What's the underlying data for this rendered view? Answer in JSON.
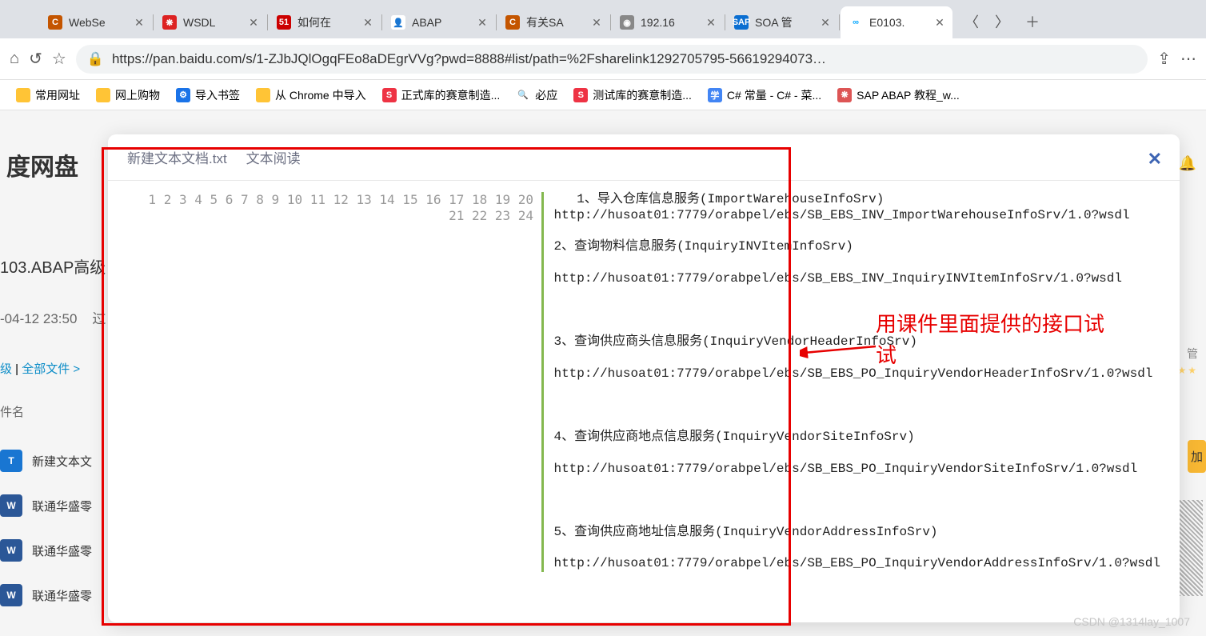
{
  "tabs": [
    {
      "title": "WebSe",
      "fav_bg": "#c45500",
      "fav_txt": "C"
    },
    {
      "title": "WSDL",
      "fav_bg": "#d22",
      "fav_txt": "❋"
    },
    {
      "title": "如何在",
      "fav_bg": "#c00",
      "fav_txt": "51"
    },
    {
      "title": "ABAP",
      "fav_bg": "#fff",
      "fav_txt": "👤",
      "fav_fg": "#333"
    },
    {
      "title": "有关SA",
      "fav_bg": "#c45500",
      "fav_txt": "C"
    },
    {
      "title": "192.16",
      "fav_bg": "#888",
      "fav_txt": "◉"
    },
    {
      "title": "SOA 管",
      "fav_bg": "#0a6ed1",
      "fav_txt": "SAP"
    },
    {
      "title": "E0103.",
      "fav_bg": "#fff",
      "fav_txt": "∞",
      "fav_fg": "#06a7ff",
      "active": true
    }
  ],
  "url": "https://pan.baidu.com/s/1-ZJbJQlOgqFEo8aDEgrVVg?pwd=8888#list/path=%2Fsharelink1292705795-56619294073…",
  "bookmarks": [
    {
      "title": "常用网址",
      "bg": "#ffc436",
      "txt": ""
    },
    {
      "title": "网上购物",
      "bg": "#ffc436",
      "txt": ""
    },
    {
      "title": "导入书签",
      "bg": "#1a73e8",
      "txt": "⚙"
    },
    {
      "title": "从 Chrome 中导入",
      "bg": "#ffc436",
      "txt": ""
    },
    {
      "title": "正式库的赛意制造...",
      "bg": "#e34",
      "txt": "S"
    },
    {
      "title": "必应",
      "bg": "#fff",
      "txt": "🔍",
      "fg": "#1a73e8"
    },
    {
      "title": "测试库的赛意制造...",
      "bg": "#e34",
      "txt": "S"
    },
    {
      "title": "C# 常量 - C# - 菜...",
      "bg": "#4285f4",
      "txt": "学"
    },
    {
      "title": "SAP ABAP 教程_w...",
      "bg": "#d55",
      "txt": "❋"
    }
  ],
  "bg": {
    "brand": "度网盘",
    "title": "103.ABAP高级",
    "time": "-04-12 23:50",
    "time2": "过",
    "nav_a": "级",
    "nav_sep": " | ",
    "nav_b": "全部文件 >",
    "head": "件名",
    "files": [
      "新建文本文",
      "联通华盛零",
      "联通华盛零",
      "联通华盛零"
    ],
    "btn": "加",
    "note": "管"
  },
  "modal": {
    "file": "新建文本文档.txt",
    "mode": "文本阅读",
    "lines": [
      "   1、导入仓库信息服务(ImportWarehouseInfoSrv)",
      "http://husoat01:7779/orabpel/ebs/SB_EBS_INV_ImportWarehouseInfoSrv/1.0?wsdl",
      "",
      "2、查询物料信息服务(InquiryINVItemInfoSrv)",
      "",
      "http://husoat01:7779/orabpel/ebs/SB_EBS_INV_InquiryINVItemInfoSrv/1.0?wsdl",
      "",
      "",
      "",
      "3、查询供应商头信息服务(InquiryVendorHeaderInfoSrv)",
      "",
      "http://husoat01:7779/orabpel/ebs/SB_EBS_PO_InquiryVendorHeaderInfoSrv/1.0?wsdl",
      "",
      "",
      "",
      "4、查询供应商地点信息服务(InquiryVendorSiteInfoSrv)",
      "",
      "http://husoat01:7779/orabpel/ebs/SB_EBS_PO_InquiryVendorSiteInfoSrv/1.0?wsdl",
      "",
      "",
      "",
      "5、查询供应商地址信息服务(InquiryVendorAddressInfoSrv)",
      "",
      "http://husoat01:7779/orabpel/ebs/SB_EBS_PO_InquiryVendorAddressInfoSrv/1.0?wsdl"
    ]
  },
  "annotation": "用课件里面提供的接口试\n试",
  "watermark": "CSDN @1314lay_1007"
}
